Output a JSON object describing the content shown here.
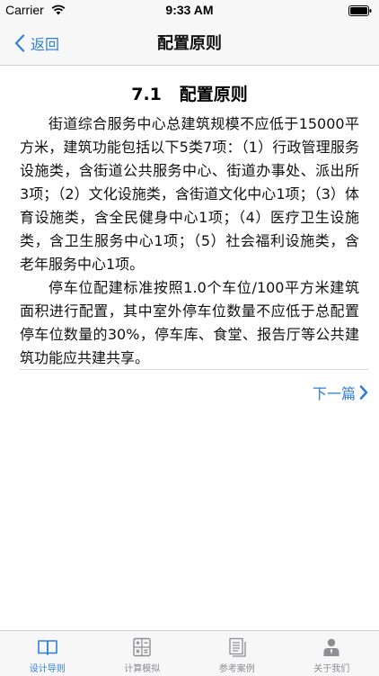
{
  "status_bar": {
    "carrier": "Carrier",
    "time": "9:33 AM",
    "wifi_icon": "wifi-icon",
    "battery_icon": "battery-icon"
  },
  "nav": {
    "back_label": "返回",
    "title": "配置原则"
  },
  "article": {
    "heading": "7.1   配置原则",
    "paragraphs": [
      "街道综合服务中心总建筑规模不应低于15000平方米，建筑功能包括以下5类7项：（1）行政管理服务设施类，含街道公共服务中心、街道办事处、派出所3项；（2）文化设施类，含街道文化中心1项；（3）体育设施类，含全民健身中心1项；（4）医疗卫生设施类，含卫生服务中心1项；（5）社会福利设施类，含老年服务中心1项。",
      "停车位配建标准按照1.0个车位/100平方米建筑面积进行配置，其中室外停车位数量不应低于总配置停车位数量的30%，停车库、食堂、报告厅等公共建筑功能应共建共享。"
    ]
  },
  "next_link": {
    "label": "下一篇"
  },
  "tabs": [
    {
      "label": "设计导则",
      "icon": "book-icon",
      "active": true
    },
    {
      "label": "计算模拟",
      "icon": "calculator-icon",
      "active": false
    },
    {
      "label": "参考案例",
      "icon": "document-icon",
      "active": false
    },
    {
      "label": "关于我们",
      "icon": "person-icon",
      "active": false
    }
  ],
  "colors": {
    "accent": "#2f7fd8",
    "inactive": "#8e8e93",
    "bar_background": "#f7f7f7"
  }
}
